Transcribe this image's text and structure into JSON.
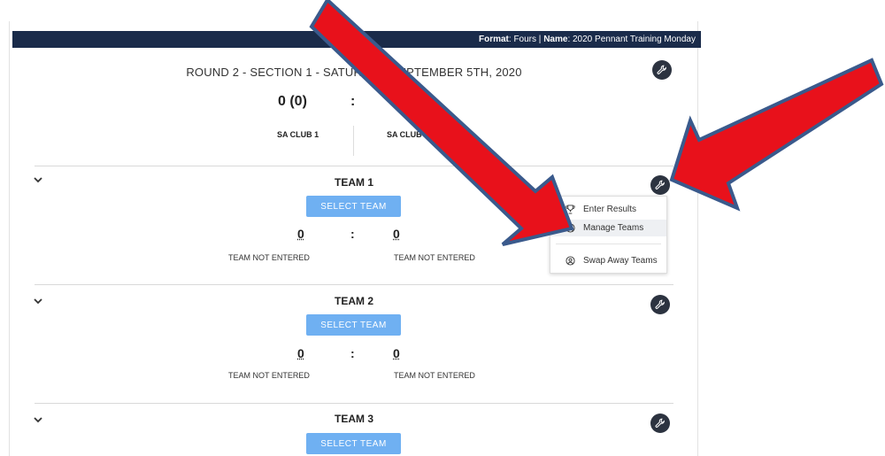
{
  "header": {
    "format_label": "Format",
    "format_value": "Fours",
    "separator": "|",
    "name_label": "Name",
    "name_value": "2020 Pennant Training Monday"
  },
  "round": {
    "title": "ROUND 2 - SECTION 1 - SATURDAY, SEPTEMBER 5TH, 2020",
    "home_score": "0 (0)",
    "colon": ":",
    "home_club": "SA CLUB 1",
    "away_club": "SA CLUB 2"
  },
  "teams": [
    {
      "title": "TEAM 1",
      "select_label": "SELECT TEAM",
      "home_score": "0",
      "away_score": "0",
      "colon": ":",
      "home_status": "TEAM NOT ENTERED",
      "away_status": "TEAM NOT ENTERED"
    },
    {
      "title": "TEAM 2",
      "select_label": "SELECT TEAM",
      "home_score": "0",
      "away_score": "0",
      "colon": ":",
      "home_status": "TEAM NOT ENTERED",
      "away_status": "TEAM NOT ENTERED"
    },
    {
      "title": "TEAM 3",
      "select_label": "SELECT TEAM"
    }
  ],
  "menu": {
    "items": [
      {
        "label": "Enter Results",
        "icon": "trophy-icon"
      },
      {
        "label": "Manage Teams",
        "icon": "user-circle-icon"
      },
      {
        "label": "Swap Away Teams",
        "icon": "user-circle-icon"
      }
    ]
  },
  "icons": {
    "wrench": "wrench-icon",
    "chevron": "chevron-down-icon"
  },
  "colors": {
    "header_bg": "#1a2b4a",
    "button_bg": "#6fb0f2",
    "wrench_bg": "#2c3340",
    "arrow_fill": "#e8111b",
    "arrow_stroke": "#3a5a8c"
  }
}
